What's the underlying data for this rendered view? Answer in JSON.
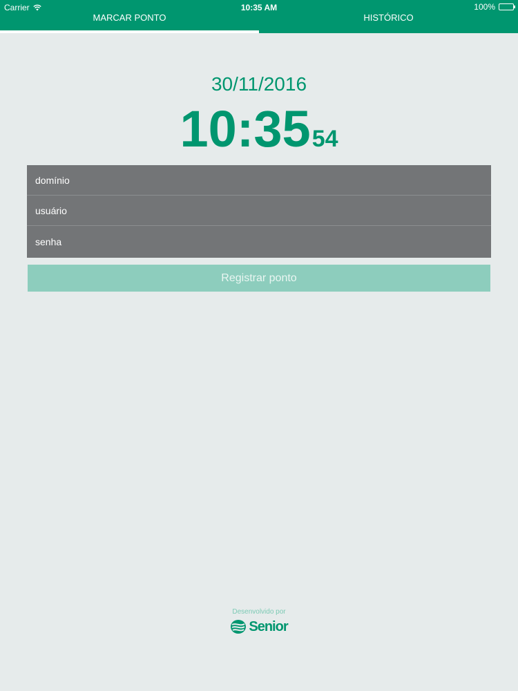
{
  "status_bar": {
    "carrier": "Carrier",
    "time": "10:35 AM",
    "battery": "100%"
  },
  "tabs": [
    {
      "label": "MARCAR PONTO",
      "active": true
    },
    {
      "label": "HISTÓRICO",
      "active": false
    }
  ],
  "clock": {
    "date": "30/11/2016",
    "hours_minutes": "10:35",
    "seconds": "54"
  },
  "form": {
    "domain_placeholder": "domínio",
    "user_placeholder": "usuário",
    "password_placeholder": "senha",
    "submit_label": "Registrar ponto"
  },
  "footer": {
    "developed_by": "Desenvolvido por",
    "brand": "Senior"
  },
  "colors": {
    "accent": "#00966f",
    "background": "#e6ebeb",
    "form": "#737577",
    "button": "#8dcdbd"
  }
}
